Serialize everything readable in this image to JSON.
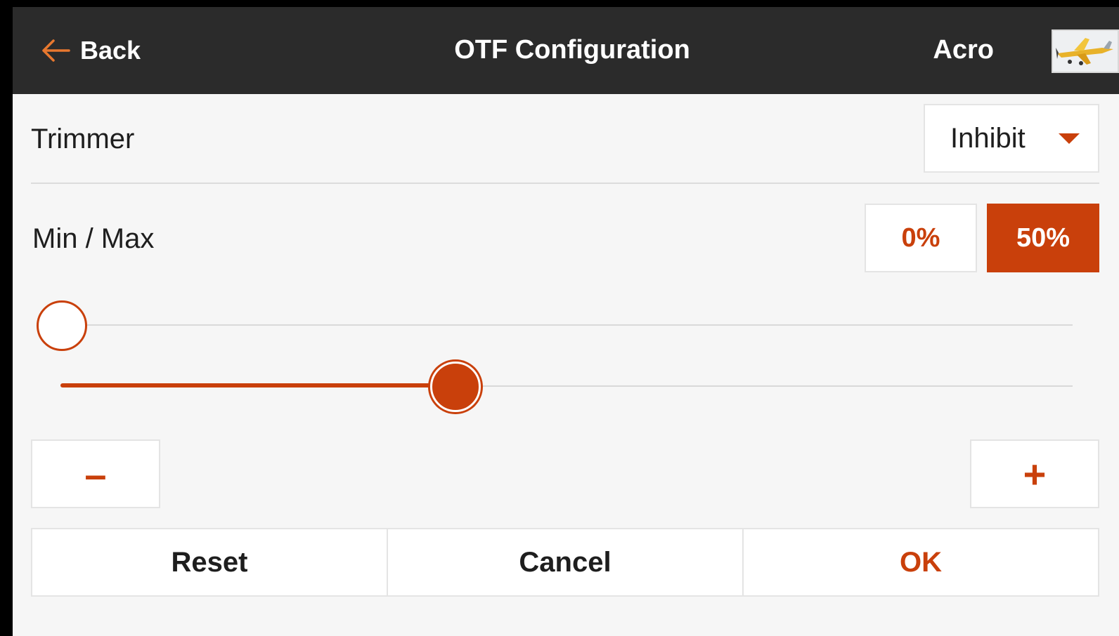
{
  "header": {
    "back_label": "Back",
    "title": "OTF Configuration",
    "model_name": "Acro",
    "back_icon": "arrow-left-icon",
    "model_icon": "airplane-icon"
  },
  "trimmer": {
    "label": "Trimmer",
    "value": "Inhibit"
  },
  "min_max": {
    "label": "Min / Max",
    "min_value": "0%",
    "max_value": "50%",
    "min_fraction": 0.0,
    "max_fraction": 0.5
  },
  "stepper": {
    "minus_label": "–",
    "plus_label": "+"
  },
  "actions": {
    "reset": "Reset",
    "cancel": "Cancel",
    "ok": "OK"
  },
  "colors": {
    "accent": "#c9400b",
    "header_bg": "#2b2b2b",
    "panel_bg": "#f6f6f6"
  }
}
